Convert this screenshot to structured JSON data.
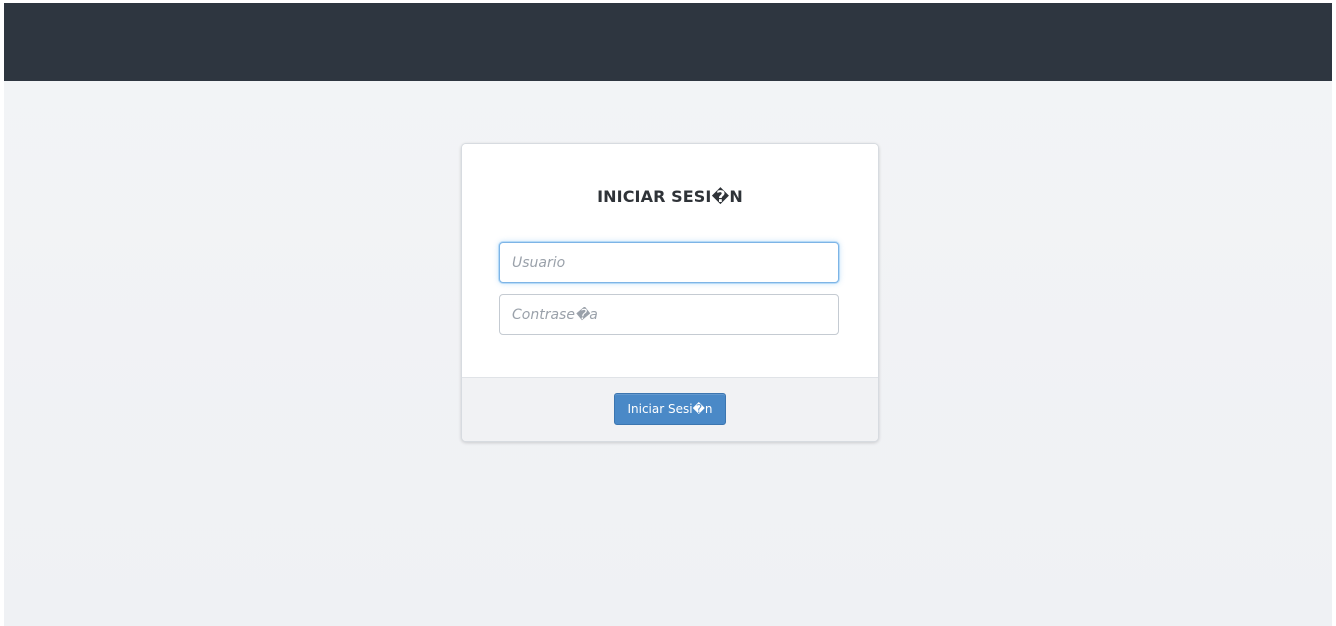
{
  "header": {
    "background_color": "#2e3640"
  },
  "login": {
    "title": "INICIAR SESI�N",
    "username": {
      "value": "",
      "placeholder": "Usuario"
    },
    "password": {
      "value": "",
      "placeholder": "Contrase�a"
    },
    "submit_label": "Iniciar Sesi�n"
  },
  "colors": {
    "page_background": "#f2f3f5",
    "card_background": "#ffffff",
    "footer_background": "#f1f2f4",
    "focus_border": "#7db4e6",
    "primary_button": "#4a89c7"
  }
}
